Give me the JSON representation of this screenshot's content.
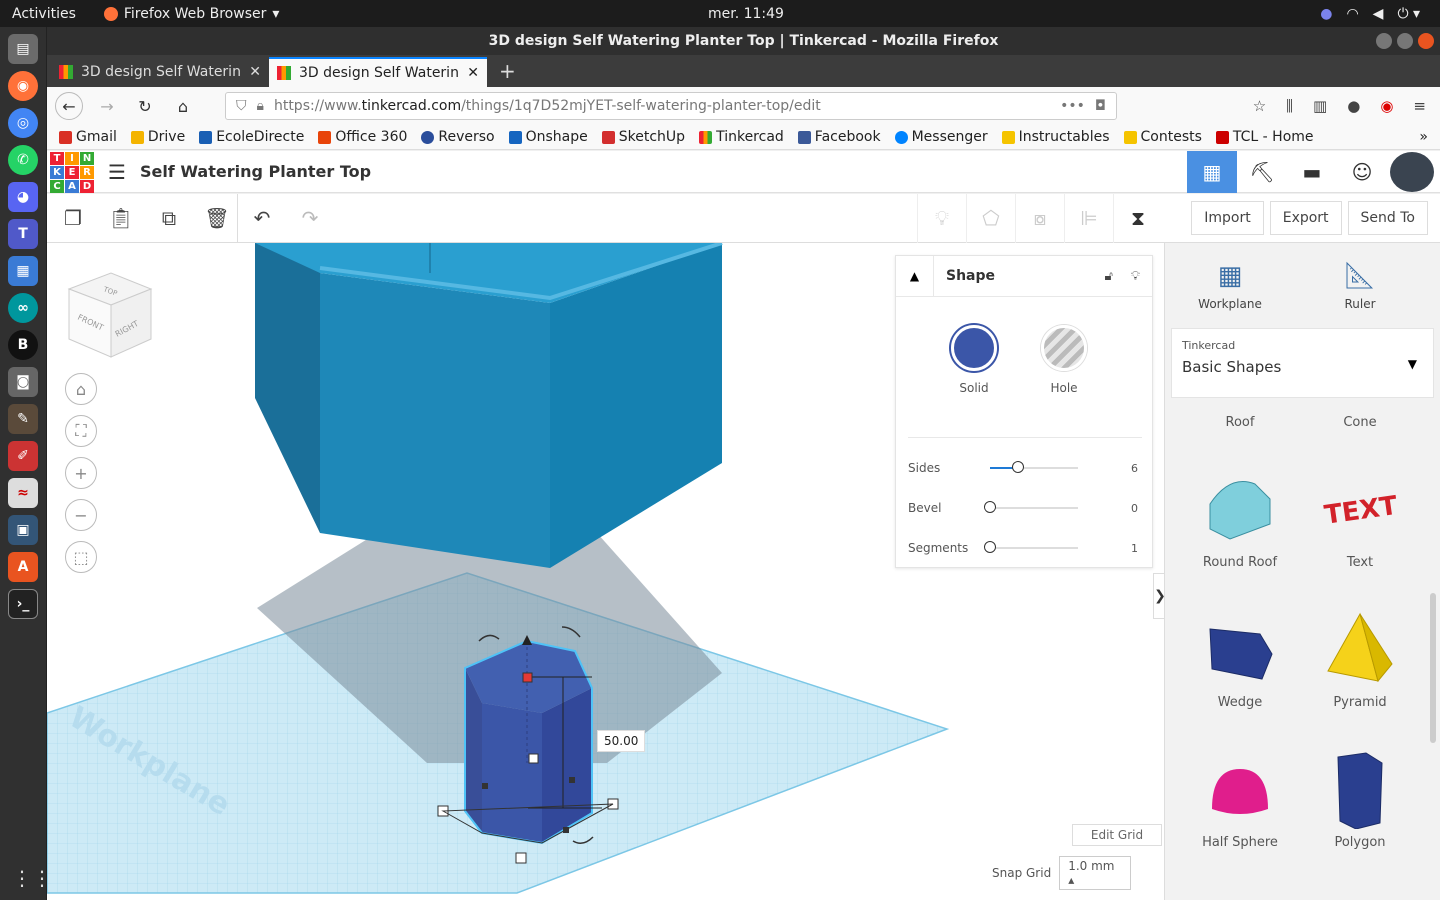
{
  "system": {
    "activities": "Activities",
    "app_name": "Firefox Web Browser",
    "clock": "mer. 11:49"
  },
  "window": {
    "title": "3D design Self Watering Planter Top | Tinkercad - Mozilla Firefox"
  },
  "tabs": [
    {
      "label": "3D design Self Watering"
    },
    {
      "label": "3D design Self Watering"
    }
  ],
  "url": {
    "prefix": "https://www.",
    "domain": "tinkercad.com",
    "path": "/things/1q7D52mjYET-self-watering-planter-top/edit"
  },
  "bookmarks": [
    {
      "label": "Gmail",
      "color": "#d93025"
    },
    {
      "label": "Drive",
      "color": "#f4b400"
    },
    {
      "label": "EcoleDirecte",
      "color": "#1a5fb4"
    },
    {
      "label": "Office 360",
      "color": "#e8440a"
    },
    {
      "label": "Reverso",
      "color": "#2a4d9b"
    },
    {
      "label": "Onshape",
      "color": "#1565c0"
    },
    {
      "label": "SketchUp",
      "color": "#d32f2f"
    },
    {
      "label": "Tinkercad",
      "color": "#e23"
    },
    {
      "label": "Facebook",
      "color": "#3b5998"
    },
    {
      "label": "Messenger",
      "color": "#0084ff"
    },
    {
      "label": "Instructables",
      "color": "#f5c400"
    },
    {
      "label": "Contests",
      "color": "#f5c400"
    },
    {
      "label": "TCL - Home",
      "color": "#c00"
    }
  ],
  "tinkercad": {
    "logo": [
      "TIN",
      "KER",
      "CAD"
    ],
    "design_title": "Self Watering Planter Top",
    "toolbar": {
      "import": "Import",
      "export": "Export",
      "send_to": "Send To"
    },
    "shape_panel": {
      "title": "Shape",
      "solid": "Solid",
      "hole": "Hole",
      "solid_color": "#3b56a8",
      "sliders": [
        {
          "label": "Sides",
          "value": "6",
          "fraction": 0.32
        },
        {
          "label": "Bevel",
          "value": "0",
          "fraction": 0
        },
        {
          "label": "Segments",
          "value": "1",
          "fraction": 0
        }
      ]
    },
    "measure_label": "50.00",
    "workplane_label": "Workplane",
    "view_cube": {
      "top": "TOP",
      "front": "FRONT",
      "right": "RIGHT"
    },
    "grid": {
      "edit_grid": "Edit Grid",
      "snap_grid": "Snap Grid",
      "snap_value": "1.0 mm"
    },
    "sidebar": {
      "workplane": "Workplane",
      "ruler": "Ruler",
      "library_source": "Tinkercad",
      "library_name": "Basic Shapes",
      "shapes": [
        "Roof",
        "Cone",
        "Round Roof",
        "Text",
        "Wedge",
        "Pyramid",
        "Half Sphere",
        "Polygon"
      ]
    }
  }
}
